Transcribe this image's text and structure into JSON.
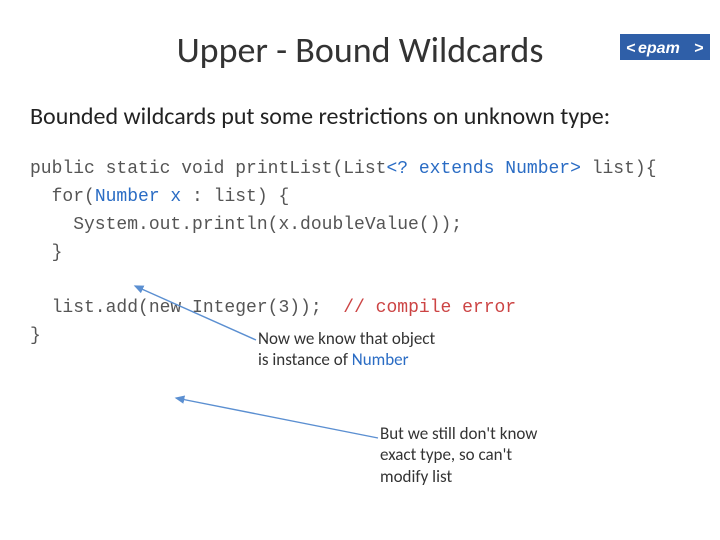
{
  "logo": {
    "text": "epam"
  },
  "title": "Upper - Bound Wildcards",
  "subtitle": "Bounded wildcards put some restrictions on unknown type:",
  "code": {
    "line1a": "public static void printList(List",
    "line1b": "<? extends Number>",
    "line1c": " list){",
    "line2a": "  for(",
    "line2b": "Number x",
    "line2c": " : list) {",
    "line3": "    System.out.println(x.doubleValue());",
    "line4": "  }",
    "line5": "",
    "line6a": "  list.add(new Integer(3));  ",
    "line6b": "// compile error",
    "line7": "}"
  },
  "annotation1": {
    "l1": "Now we know that object",
    "l2a": "is instance of ",
    "l2b": "Number"
  },
  "annotation2": {
    "l1": "But we still don't know",
    "l2": "exact type, so can't",
    "l3": "modify list"
  }
}
